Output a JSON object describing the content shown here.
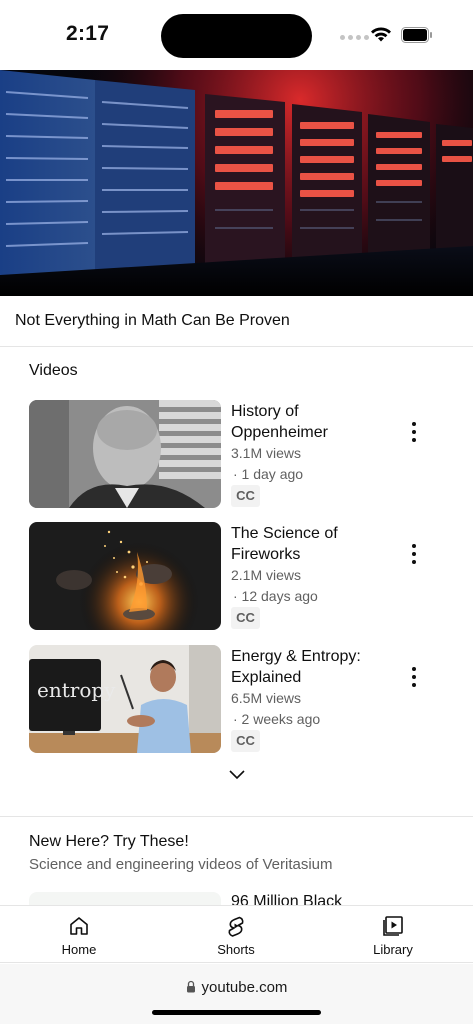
{
  "status_bar": {
    "time": "2:17"
  },
  "channel": {
    "banner_title": "Not Everything in Math Can Be Proven"
  },
  "videos_section": {
    "heading": "Videos",
    "items": [
      {
        "title": "History of Oppenheimer",
        "views": "3.1M views",
        "age": "· 1 day ago",
        "badge": "CC"
      },
      {
        "title": "The Science of Fireworks",
        "views": "2.1M views",
        "age": "· 12 days ago",
        "badge": "CC"
      },
      {
        "title": "Energy & Entropy: Explained",
        "views": "6.5M views",
        "age": "· 2 weeks ago",
        "badge": "CC",
        "thumb_text": "entropy"
      }
    ]
  },
  "promo_section": {
    "title": "New Here? Try These!",
    "subtitle": "Science and engineering videos of Veritasium",
    "peek_title": "96 Million Black"
  },
  "bottom_nav": {
    "home": "Home",
    "shorts": "Shorts",
    "library": "Library"
  },
  "browser": {
    "url": "youtube.com"
  },
  "colors": {
    "text": "#0f0f0f",
    "secondary": "#606060",
    "banner_red": "#ff2a2a",
    "banner_blue": "#2a5cb8"
  }
}
